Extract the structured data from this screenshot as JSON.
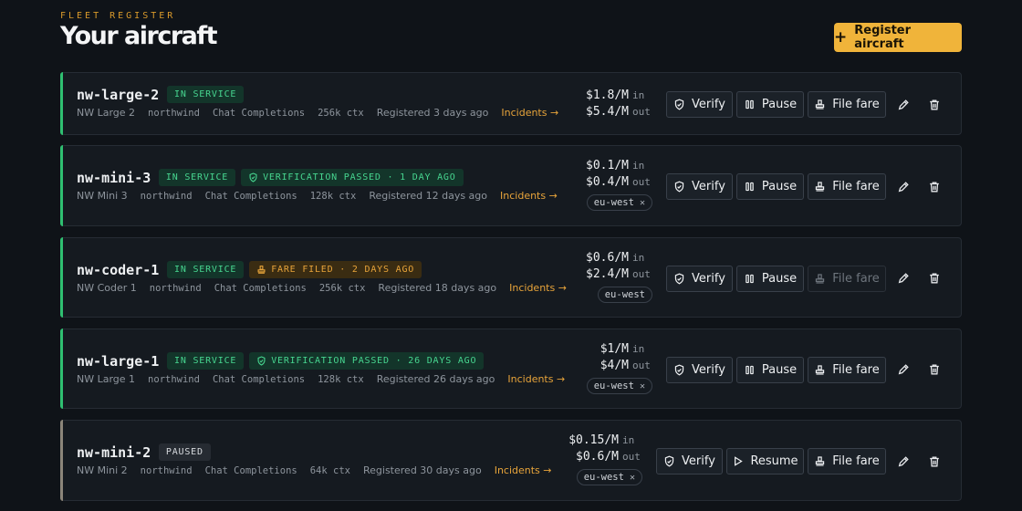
{
  "header": {
    "eyebrow": "FLEET REGISTER",
    "title": "Your aircraft",
    "register_label": "Register aircraft"
  },
  "actions": {
    "verify": "Verify",
    "pause": "Pause",
    "resume": "Resume",
    "file_fare": "File fare"
  },
  "colors": {
    "accent_service": "#2fbf71",
    "accent_paused": "#8b8579",
    "brand": "#f0b43a"
  },
  "aircraft": [
    {
      "name": "nw-large-2",
      "status": "IN SERVICE",
      "extra_badge": null,
      "model": "NW Large 2",
      "provider": "northwind",
      "api": "Chat Completions",
      "ctx": "256k ctx",
      "registered": "Registered 3 days ago",
      "incidents": "Incidents →",
      "price_in": "$1.8/M",
      "price_out": "$5.4/M",
      "in_label": "in",
      "out_label": "out",
      "region": null,
      "region_removable": false,
      "paused": false,
      "file_fare_disabled": false
    },
    {
      "name": "nw-mini-3",
      "status": "IN SERVICE",
      "extra_badge": "VERIFICATION PASSED · 1 DAY AGO",
      "extra_badge_kind": "verified",
      "model": "NW Mini 3",
      "provider": "northwind",
      "api": "Chat Completions",
      "ctx": "128k ctx",
      "registered": "Registered 12 days ago",
      "incidents": "Incidents →",
      "price_in": "$0.1/M",
      "price_out": "$0.4/M",
      "in_label": "in",
      "out_label": "out",
      "region": "eu-west",
      "region_removable": true,
      "paused": false,
      "file_fare_disabled": false
    },
    {
      "name": "nw-coder-1",
      "status": "IN SERVICE",
      "extra_badge": "FARE FILED · 2 DAYS AGO",
      "extra_badge_kind": "fare",
      "model": "NW Coder 1",
      "provider": "northwind",
      "api": "Chat Completions",
      "ctx": "256k ctx",
      "registered": "Registered 18 days ago",
      "incidents": "Incidents →",
      "price_in": "$0.6/M",
      "price_out": "$2.4/M",
      "in_label": "in",
      "out_label": "out",
      "region": "eu-west",
      "region_removable": false,
      "paused": false,
      "file_fare_disabled": true
    },
    {
      "name": "nw-large-1",
      "status": "IN SERVICE",
      "extra_badge": "VERIFICATION PASSED · 26 DAYS AGO",
      "extra_badge_kind": "verified",
      "model": "NW Large 1",
      "provider": "northwind",
      "api": "Chat Completions",
      "ctx": "128k ctx",
      "registered": "Registered 26 days ago",
      "incidents": "Incidents →",
      "price_in": "$1/M",
      "price_out": "$4/M",
      "in_label": "in",
      "out_label": "out",
      "region": "eu-west",
      "region_removable": true,
      "paused": false,
      "file_fare_disabled": false
    },
    {
      "name": "nw-mini-2",
      "status": "PAUSED",
      "extra_badge": null,
      "model": "NW Mini 2",
      "provider": "northwind",
      "api": "Chat Completions",
      "ctx": "64k ctx",
      "registered": "Registered 30 days ago",
      "incidents": "Incidents →",
      "price_in": "$0.15/M",
      "price_out": "$0.6/M",
      "in_label": "in",
      "out_label": "out",
      "region": "eu-west",
      "region_removable": true,
      "paused": true,
      "file_fare_disabled": false
    }
  ]
}
